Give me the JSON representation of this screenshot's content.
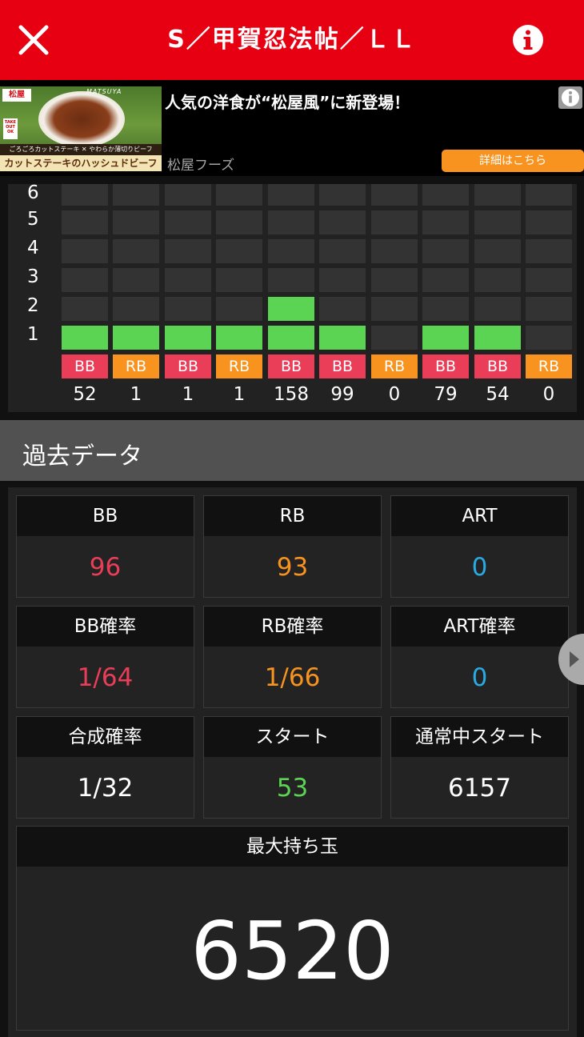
{
  "header": {
    "title": "S／甲賀忍法帖／ＬＬ",
    "background": "#e60012"
  },
  "ad": {
    "headline": "人気の洋食が“松屋風”に新登場！",
    "advertiser": "松屋フーズ",
    "button_label": "詳細はこちら",
    "image": {
      "logo": "松屋",
      "brand": "MATSUYA",
      "takeout": "TAKE OUT OK",
      "strip1": "ごろごろカットステーキ ✕ やわらか薄切りビーフ",
      "strip2": "カットステーキのハッシュドビーフ"
    }
  },
  "graph": {
    "y_labels": [
      "6",
      "5",
      "4",
      "3",
      "2",
      "1"
    ],
    "columns": [
      {
        "type": "BB",
        "count": "52",
        "level": 1
      },
      {
        "type": "RB",
        "count": "1",
        "level": 1
      },
      {
        "type": "BB",
        "count": "1",
        "level": 1
      },
      {
        "type": "RB",
        "count": "1",
        "level": 1
      },
      {
        "type": "BB",
        "count": "158",
        "level": 2
      },
      {
        "type": "BB",
        "count": "99",
        "level": 1
      },
      {
        "type": "RB",
        "count": "0",
        "level": 0
      },
      {
        "type": "BB",
        "count": "79",
        "level": 1
      },
      {
        "type": "BB",
        "count": "54",
        "level": 1
      },
      {
        "type": "RB",
        "count": "0",
        "level": 0
      }
    ],
    "colors": {
      "bb": "#ea3d58",
      "rb": "#f7931e",
      "bar": "#5cd453",
      "empty": "#333333"
    }
  },
  "section": {
    "title": "過去データ"
  },
  "stats": {
    "bb": {
      "label": "BB",
      "value": "96"
    },
    "rb": {
      "label": "RB",
      "value": "93"
    },
    "art": {
      "label": "ART",
      "value": "0"
    },
    "bb_rate": {
      "label": "BB確率",
      "value": "1/64"
    },
    "rb_rate": {
      "label": "RB確率",
      "value": "1/66"
    },
    "art_rate": {
      "label": "ART確率",
      "value": "0"
    },
    "combined_rate": {
      "label": "合成確率",
      "value": "1/32"
    },
    "start": {
      "label": "スタート",
      "value": "53"
    },
    "normal_start": {
      "label": "通常中スタート",
      "value": "6157"
    },
    "max_balls": {
      "label": "最大持ち玉",
      "value": "6520"
    }
  }
}
